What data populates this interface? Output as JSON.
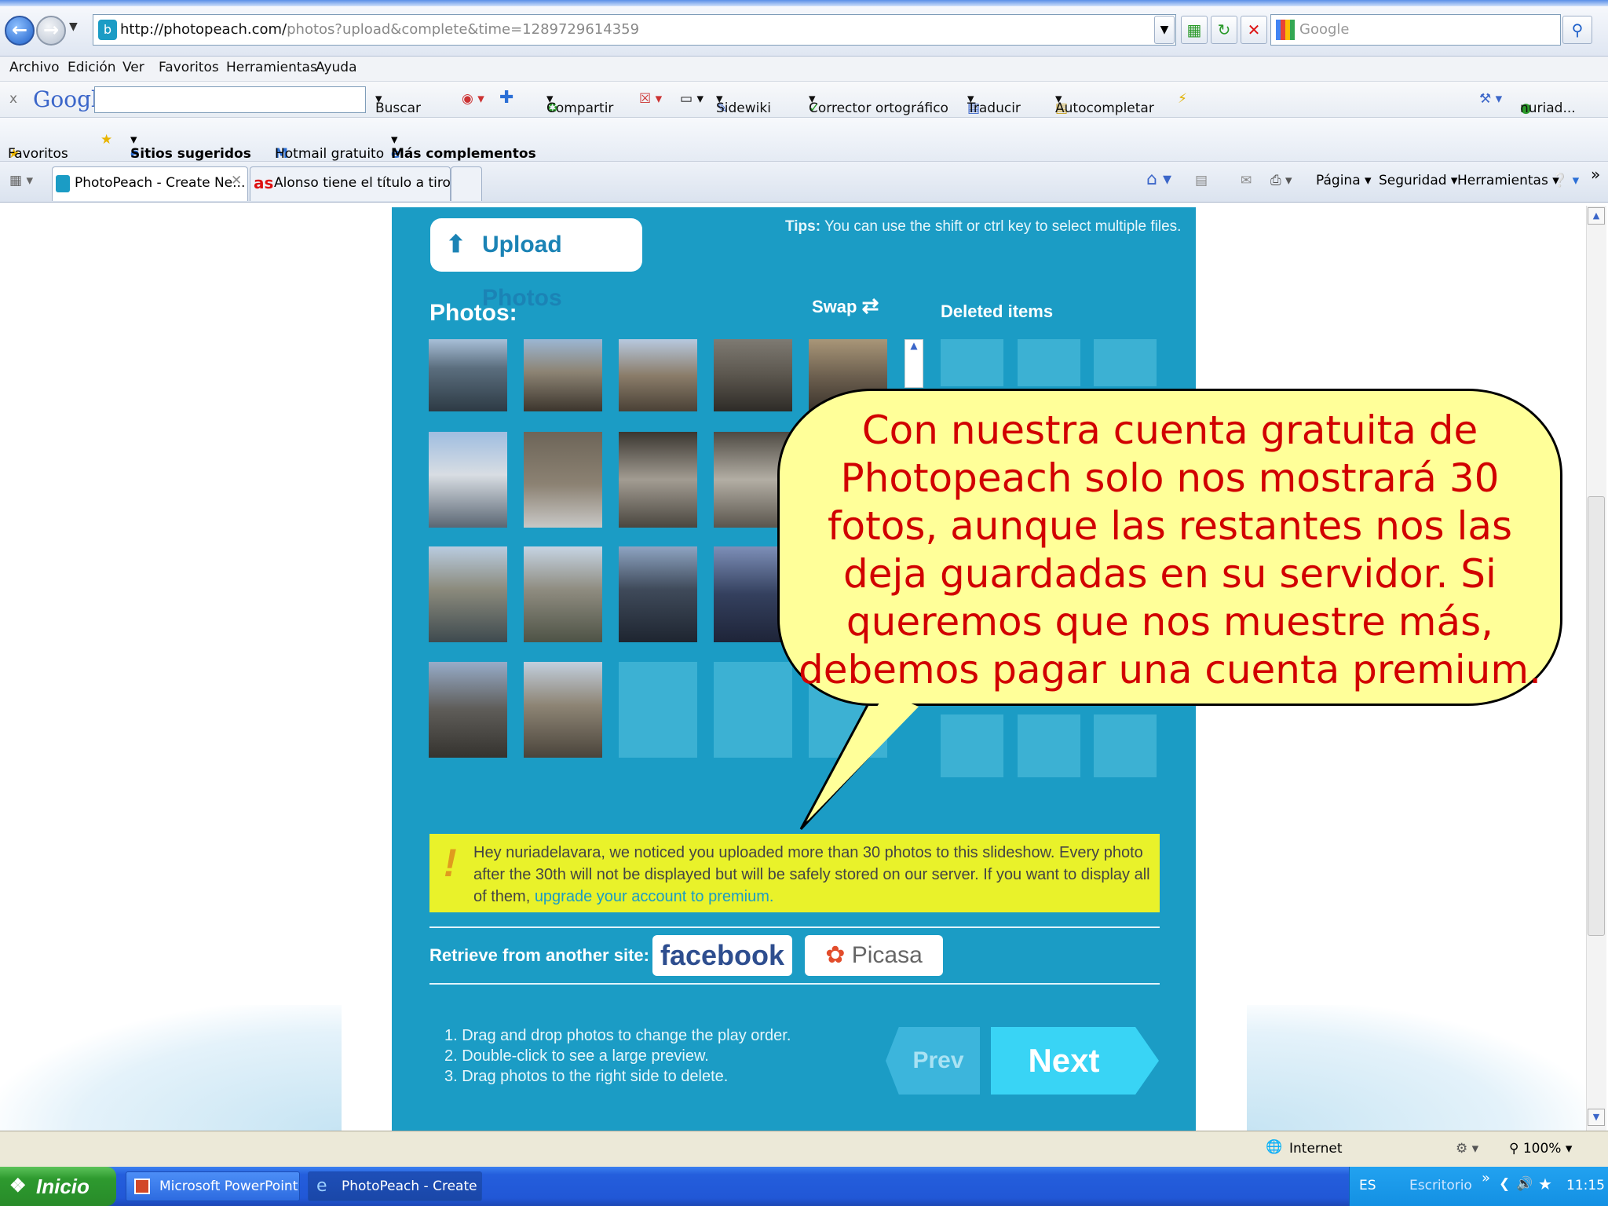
{
  "browser": {
    "url_host": "http://photopeach.com/",
    "url_path": "photos?upload&complete&time=1289729614359",
    "search_placeholder": "Google",
    "menu": [
      "Archivo",
      "Edición",
      "Ver",
      "Favoritos",
      "Herramientas",
      "Ayuda"
    ],
    "google_toolbar": {
      "logo": "Google",
      "buscar": "Buscar",
      "compartir": "Compartir",
      "sidewiki": "Sidewiki",
      "corrector": "Corrector ortográfico",
      "traducir": "Traducir",
      "autocompletar": "Autocompletar",
      "user": "nuriad..."
    },
    "favorites": {
      "favoritos": "Favoritos",
      "sitios": "Sitios sugeridos",
      "hotmail": "Hotmail gratuito",
      "complementos": "Más complementos"
    },
    "tabs": [
      "PhotoPeach - Create Ne...",
      "Alonso tiene el título a tiro de..."
    ],
    "commands": {
      "pagina": "Página",
      "seguridad": "Seguridad",
      "herramientas": "Herramientas"
    },
    "status": {
      "zone": "Internet",
      "zoom": "100%"
    }
  },
  "app": {
    "upload_button": "Upload Photos",
    "tips_label": "Tips:",
    "tips_text": "You can use the shift or ctrl key to select multiple files.",
    "photos_label": "Photos:",
    "swap_label": "Swap",
    "deleted_label": "Deleted items",
    "warning_text": "Hey nuriadelavara, we noticed you uploaded more than 30 photos to this slideshow. Every photo after the 30th will not be displayed but will be safely stored on our server. If you want to display all of them, ",
    "warning_link": "upgrade your account to premium.",
    "retrieve_label": "Retrieve from another site:",
    "facebook": "facebook",
    "picasa": "Picasa",
    "steps": [
      "1. Drag and drop photos to change the play order.",
      "2. Double-click to see a large preview.",
      "3. Drag photos to the right side to delete."
    ],
    "prev": "Prev",
    "next": "Next"
  },
  "callout": "Con nuestra cuenta gratuita de Photopeach solo nos mostrará 30 fotos, aunque las restantes nos las deja guardadas en su servidor. Si queremos que nos muestre más, debemos pagar una cuenta premium.",
  "taskbar": {
    "start": "Inicio",
    "tasks": [
      "Microsoft PowerPoint ...",
      "PhotoPeach - Create ..."
    ],
    "lang": "ES",
    "desktop": "Escritorio",
    "time": "11:15"
  }
}
